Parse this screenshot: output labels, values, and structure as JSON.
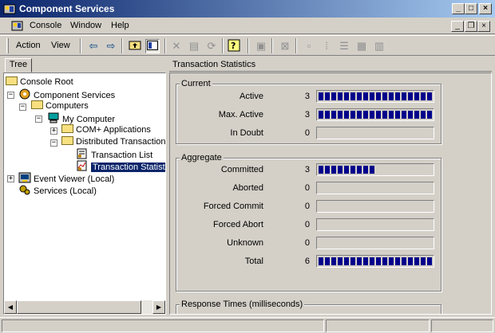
{
  "window": {
    "title": "Component Services"
  },
  "menu": {
    "items": [
      "Console",
      "Window",
      "Help"
    ]
  },
  "toolbar": {
    "action_label": "Action",
    "view_label": "View"
  },
  "tree": {
    "tab_label": "Tree",
    "nodes": [
      "Console Root",
      "Component Services",
      "Computers",
      "My Computer",
      "COM+ Applications",
      "Distributed Transaction Coordinator",
      "Transaction List",
      "Transaction Statistics",
      "Event Viewer (Local)",
      "Services (Local)"
    ]
  },
  "right": {
    "header": "Transaction Statistics",
    "groups": {
      "current": "Current",
      "aggregate": "Aggregate",
      "response": "Response Times (milliseconds)"
    },
    "current": [
      {
        "label": "Active",
        "value": "3",
        "fill": 1.0
      },
      {
        "label": "Max. Active",
        "value": "3",
        "fill": 1.0
      },
      {
        "label": "In Doubt",
        "value": "0",
        "fill": 0.0
      }
    ],
    "aggregate": [
      {
        "label": "Committed",
        "value": "3",
        "fill": 0.5
      },
      {
        "label": "Aborted",
        "value": "0",
        "fill": 0.0
      },
      {
        "label": "Forced Commit",
        "value": "0",
        "fill": 0.0
      },
      {
        "label": "Forced Abort",
        "value": "0",
        "fill": 0.0
      },
      {
        "label": "Unknown",
        "value": "0",
        "fill": 0.0
      },
      {
        "label": "Total",
        "value": "6",
        "fill": 1.0
      }
    ]
  }
}
